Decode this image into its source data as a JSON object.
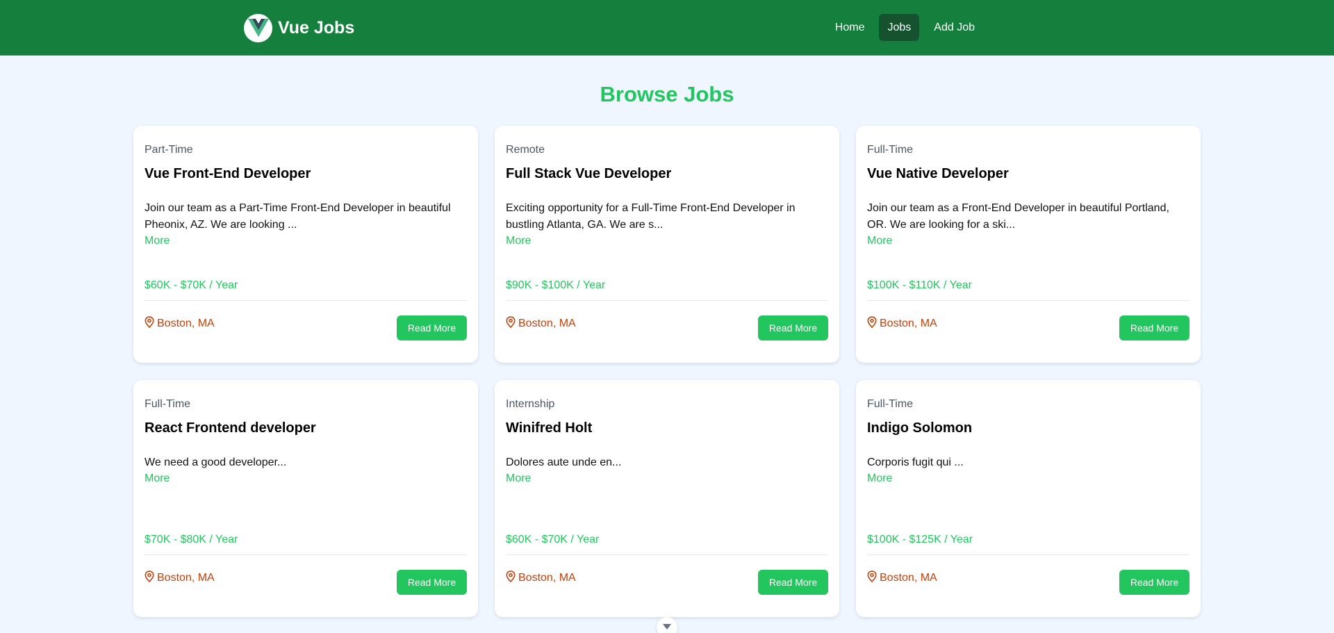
{
  "header": {
    "brand": "Vue Jobs",
    "nav": [
      {
        "label": "Home",
        "active": false
      },
      {
        "label": "Jobs",
        "active": true
      },
      {
        "label": "Add Job",
        "active": false
      }
    ]
  },
  "page_title": "Browse Jobs",
  "jobs": [
    {
      "type": "Part-Time",
      "title": "Vue Front-End Developer",
      "description": "Join our team as a Part-Time Front-End Developer in beautiful Pheonix, AZ. We are looking ...",
      "more": "More",
      "salary": "$60K - $70K / Year",
      "location": "Boston, MA",
      "button": "Read More"
    },
    {
      "type": "Remote",
      "title": "Full Stack Vue Developer",
      "description": "Exciting opportunity for a Full-Time Front-End Developer in bustling Atlanta, GA. We are s...",
      "more": "More",
      "salary": "$90K - $100K / Year",
      "location": "Boston, MA",
      "button": "Read More"
    },
    {
      "type": "Full-Time",
      "title": "Vue Native Developer",
      "description": "Join our team as a Front-End Developer in beautiful Portland, OR. We are looking for a ski...",
      "more": "More",
      "salary": "$100K - $110K / Year",
      "location": "Boston, MA",
      "button": "Read More"
    },
    {
      "type": "Full-Time",
      "title": "React Frontend developer",
      "description": "We need a good developer...",
      "more": "More",
      "salary": "$70K - $80K / Year",
      "location": "Boston, MA",
      "button": "Read More"
    },
    {
      "type": "Internship",
      "title": "Winifred Holt",
      "description": "Dolores aute unde en...",
      "more": "More",
      "salary": "$60K - $70K / Year",
      "location": "Boston, MA",
      "button": "Read More"
    },
    {
      "type": "Full-Time",
      "title": "Indigo Solomon",
      "description": "Corporis fugit qui ...",
      "more": "More",
      "salary": "$100K - $125K / Year",
      "location": "Boston, MA",
      "button": "Read More"
    }
  ],
  "icons": {
    "logo": "vue-logo-icon",
    "location": "map-pin-icon",
    "scroll": "chevron-down-icon"
  },
  "colors": {
    "nav_bg": "#15803d",
    "nav_active": "#14532d",
    "accent": "#22c55e",
    "location": "#c2410c",
    "page_bg": "#eff6ff"
  }
}
